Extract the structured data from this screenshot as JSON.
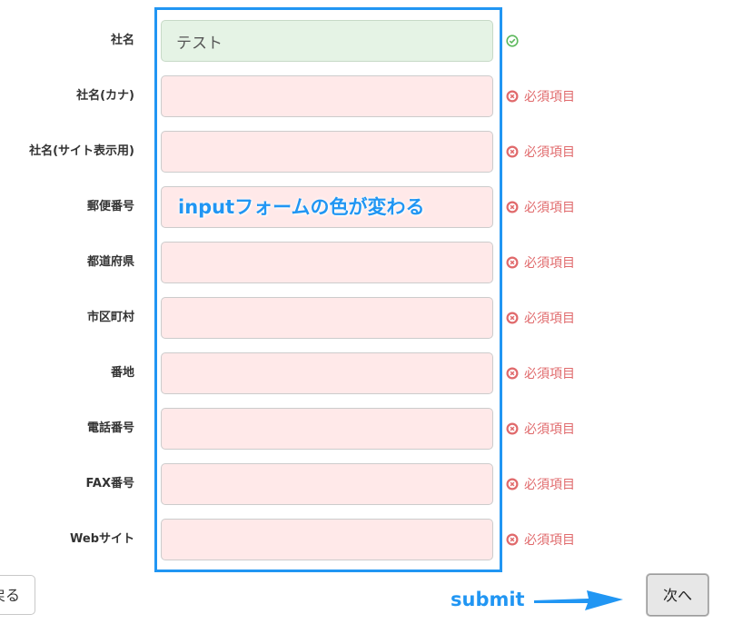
{
  "form": {
    "fields": [
      {
        "label": "社名",
        "value": "テスト",
        "status": "valid",
        "message": ""
      },
      {
        "label": "社名(カナ)",
        "value": "",
        "status": "error",
        "message": "必須項目"
      },
      {
        "label": "社名(サイト表示用)",
        "value": "",
        "status": "error",
        "message": "必須項目"
      },
      {
        "label": "郵便番号",
        "value": "",
        "status": "error",
        "message": "必須項目"
      },
      {
        "label": "都道府県",
        "value": "",
        "status": "error",
        "message": "必須項目"
      },
      {
        "label": "市区町村",
        "value": "",
        "status": "error",
        "message": "必須項目"
      },
      {
        "label": "番地",
        "value": "",
        "status": "error",
        "message": "必須項目"
      },
      {
        "label": "電話番号",
        "value": "",
        "status": "error",
        "message": "必須項目"
      },
      {
        "label": "FAX番号",
        "value": "",
        "status": "error",
        "message": "必須項目"
      },
      {
        "label": "Webサイト",
        "value": "",
        "status": "error",
        "message": "必須項目"
      }
    ]
  },
  "annotations": {
    "input_color_note": "inputフォームの色が変わる",
    "submit_note": "submit"
  },
  "buttons": {
    "back_label": "戻る",
    "next_label": "次へ"
  },
  "colors": {
    "valid_input_bg": "#e5f3e5",
    "error_input_bg": "#ffe9e9",
    "error_text": "#e0696b",
    "valid_icon": "#5cb85c",
    "annotation_blue": "#2196f3"
  }
}
